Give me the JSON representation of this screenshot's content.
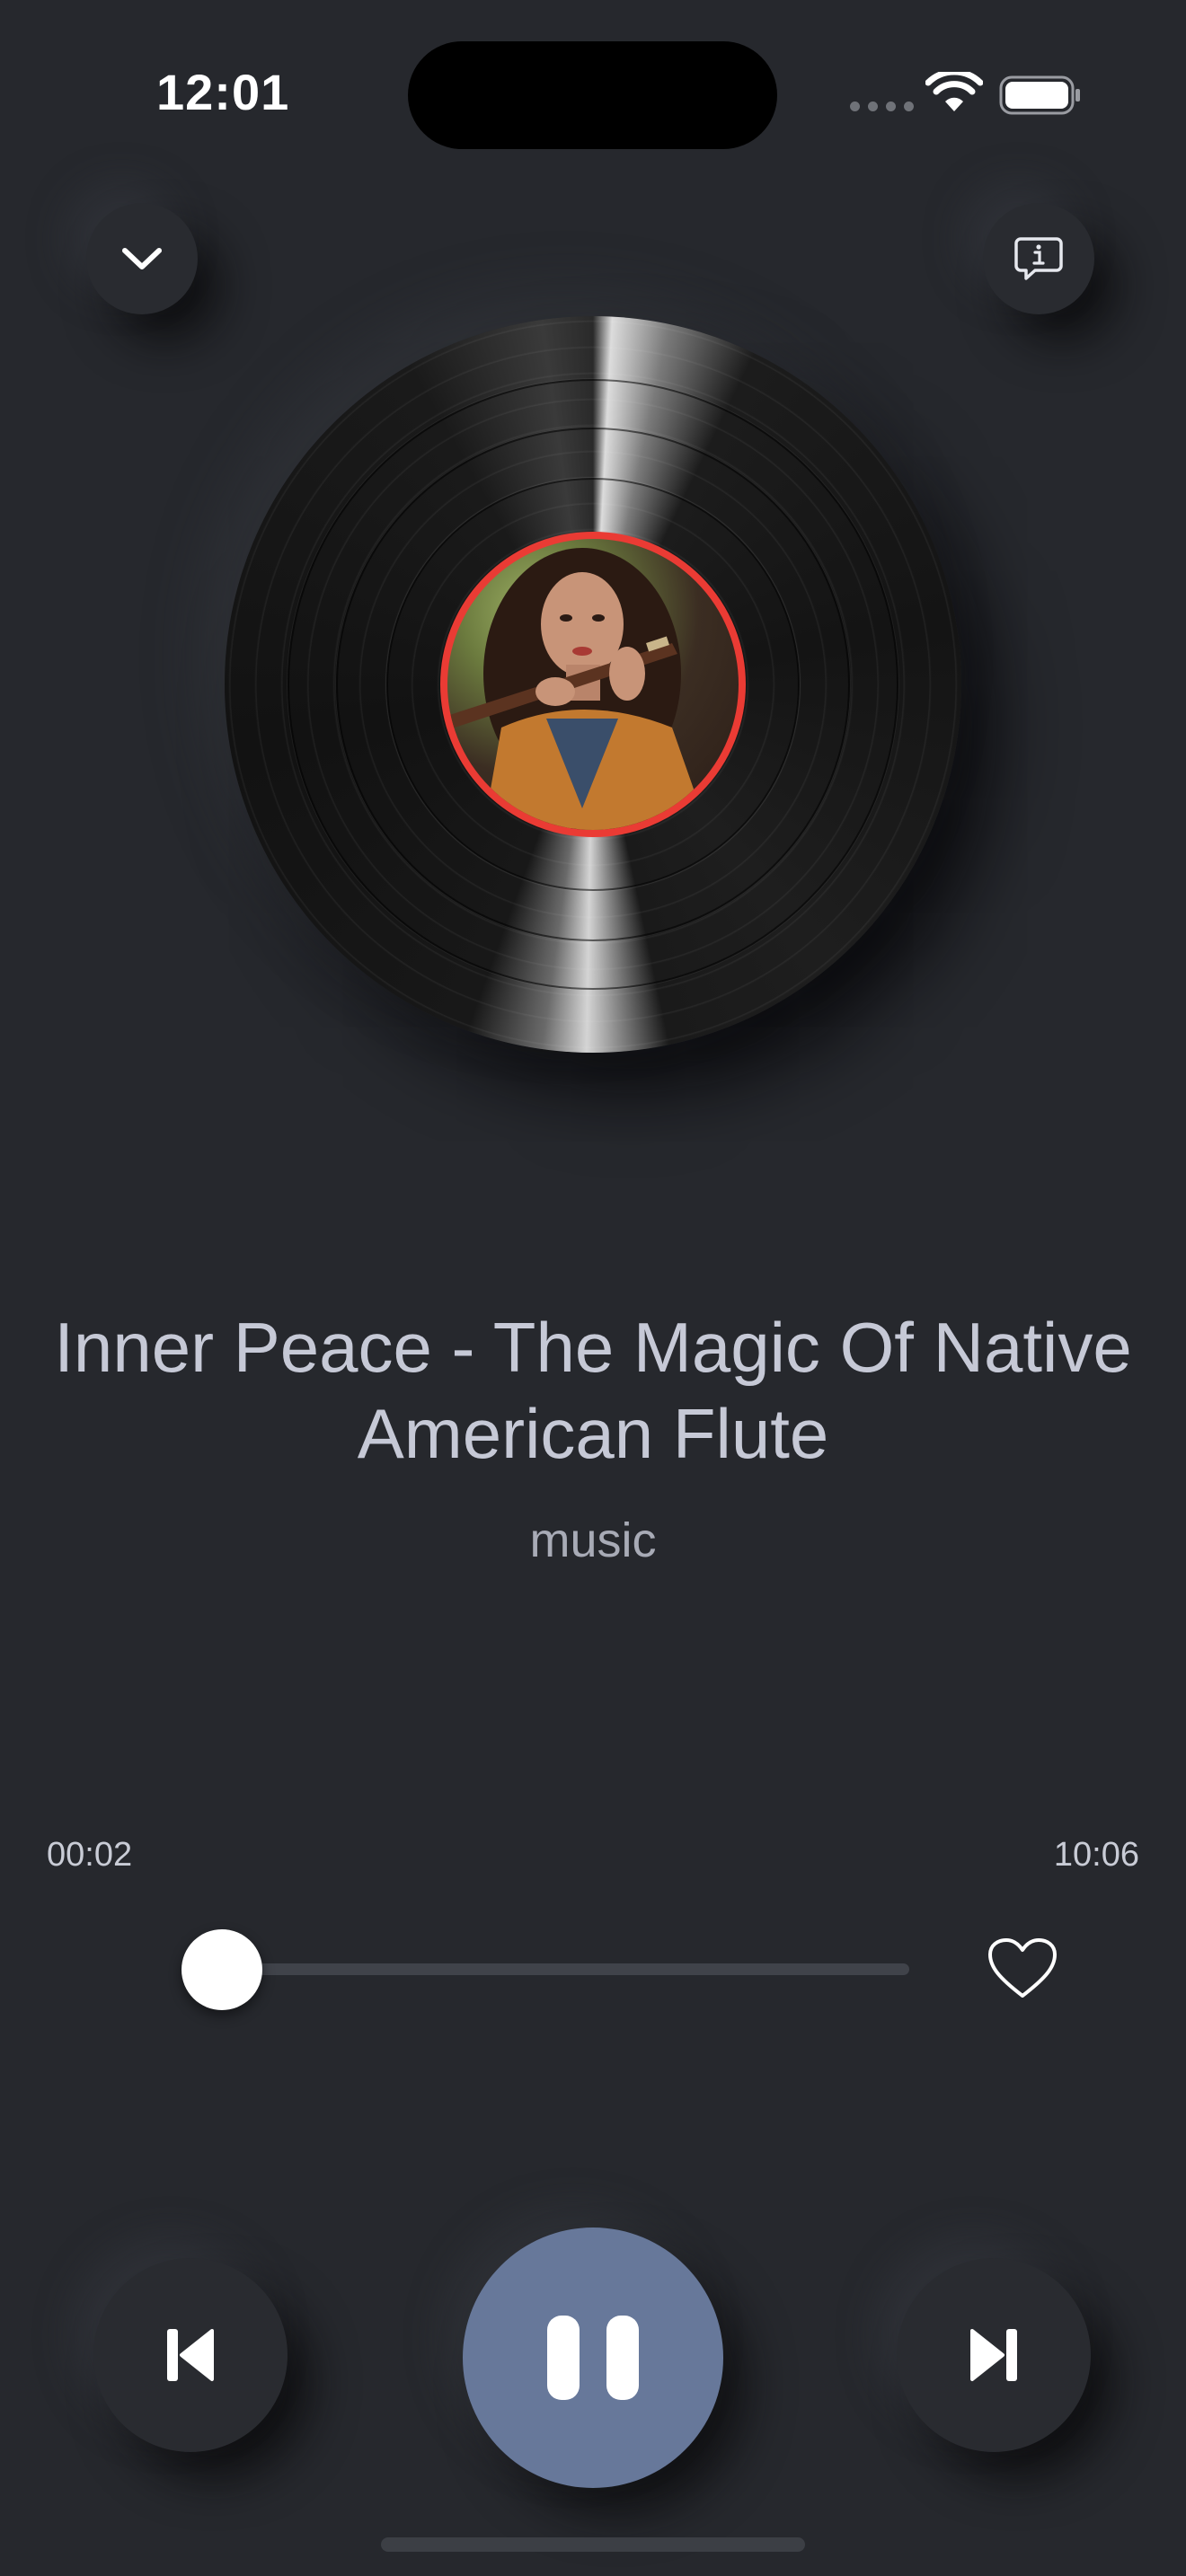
{
  "status_bar": {
    "time": "12:01",
    "icons": [
      "signal-dots-icon",
      "wifi-icon",
      "battery-icon"
    ]
  },
  "header": {
    "collapse_icon": "chevron-down-icon",
    "info_icon": "info-bubble-icon"
  },
  "now_playing": {
    "title": "Inner Peace - The Magic Of Native American Flute",
    "subtitle": "music",
    "album_art_accent": "#ea3b34"
  },
  "progress": {
    "current_time": "00:02",
    "total_time": "10:06",
    "fraction": 0.003,
    "favorite_icon": "heart-outline-icon"
  },
  "controls": {
    "previous_icon": "skip-previous-icon",
    "play_pause_icon": "pause-icon",
    "next_icon": "skip-next-icon",
    "play_button_color": "#67789a"
  },
  "colors": {
    "background": "#26282d",
    "text": "#c6c9d6"
  }
}
